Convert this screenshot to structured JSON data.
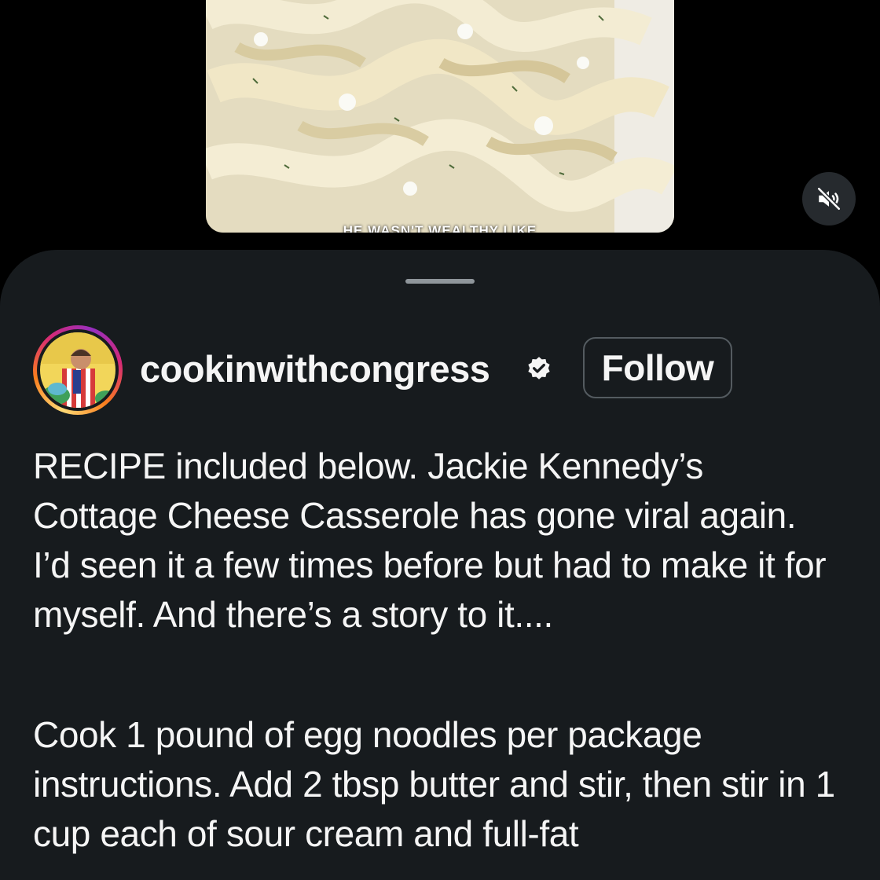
{
  "video": {
    "overlay_text": "HE WASN'T WEALTHY LIKE",
    "mute_icon": "speaker-muted-icon"
  },
  "post": {
    "username": "cookinwithcongress",
    "verified_icon": "verified-badge-icon",
    "follow_label": "Follow",
    "caption_paragraph_1": "RECIPE included below. Jackie Kennedy’s Cottage Cheese Casserole has gone viral again. I’d seen it a few times before but had to make it for myself. And there’s a story to it....",
    "caption_paragraph_2": "Cook 1 pound of egg noodles per package instructions. Add 2 tbsp butter and stir, then stir in 1 cup each of sour cream and full-fat"
  },
  "colors": {
    "sheet_background": "#171b1e",
    "text": "#f5f5f5",
    "follow_border": "#545b60",
    "handle": "#8f969b"
  }
}
